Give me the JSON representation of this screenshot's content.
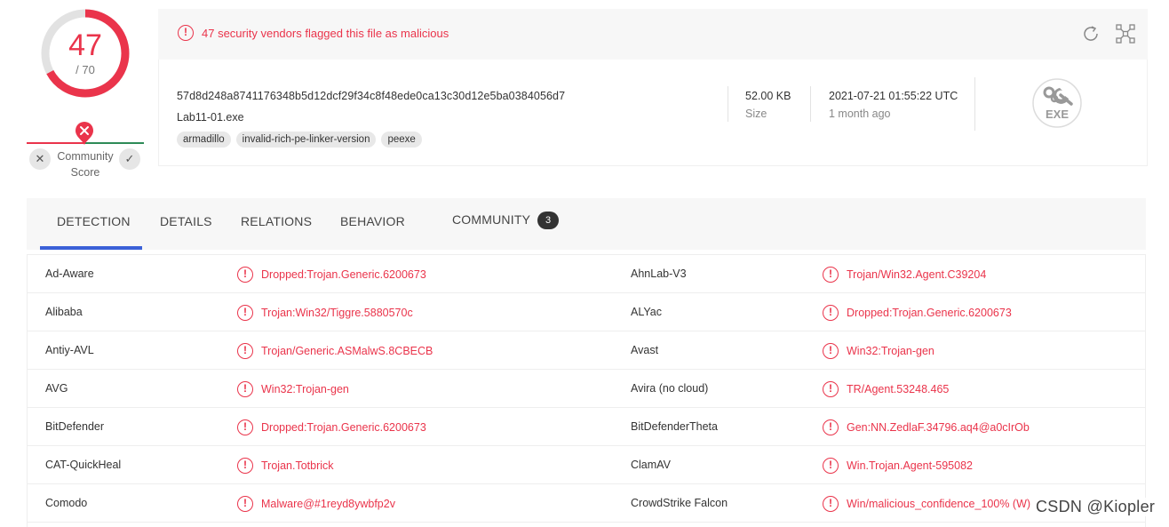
{
  "score": {
    "detected": "47",
    "total": "/ 70",
    "fraction": 0.671,
    "community_label_1": "Community",
    "community_label_2": "Score",
    "accent": "#ea344b"
  },
  "header": {
    "alert": "47 security vendors flagged this file as malicious",
    "sha256": "57d8d248a8741176348b5d12dcf29f34c8f48ede0ca13c30d12e5ba0384056d7",
    "filename": "Lab11-01.exe",
    "tags": [
      "armadillo",
      "invalid-rich-pe-linker-version",
      "peexe"
    ],
    "size_value": "52.00 KB",
    "size_label": "Size",
    "date_value": "2021-07-21 01:55:22 UTC",
    "date_ago": "1 month ago",
    "file_type": "EXE",
    "icons": [
      "refresh-icon",
      "graph-icon",
      "exe-file-icon"
    ]
  },
  "tabs": [
    {
      "label": "DETECTION",
      "active": true
    },
    {
      "label": "DETAILS"
    },
    {
      "label": "RELATIONS"
    },
    {
      "label": "BEHAVIOR"
    },
    {
      "label": "COMMUNITY",
      "badge": "3"
    }
  ],
  "detections": [
    {
      "vendor_left": "Ad-Aware",
      "result_left": "Dropped:Trojan.Generic.6200673",
      "vendor_right": "AhnLab-V3",
      "result_right": "Trojan/Win32.Agent.C39204"
    },
    {
      "vendor_left": "Alibaba",
      "result_left": "Trojan:Win32/Tiggre.5880570c",
      "vendor_right": "ALYac",
      "result_right": "Dropped:Trojan.Generic.6200673"
    },
    {
      "vendor_left": "Antiy-AVL",
      "result_left": "Trojan/Generic.ASMalwS.8CBECB",
      "vendor_right": "Avast",
      "result_right": "Win32:Trojan-gen"
    },
    {
      "vendor_left": "AVG",
      "result_left": "Win32:Trojan-gen",
      "vendor_right": "Avira (no cloud)",
      "result_right": "TR/Agent.53248.465"
    },
    {
      "vendor_left": "BitDefender",
      "result_left": "Dropped:Trojan.Generic.6200673",
      "vendor_right": "BitDefenderTheta",
      "result_right": "Gen:NN.ZedlaF.34796.aq4@a0cIrOb"
    },
    {
      "vendor_left": "CAT-QuickHeal",
      "result_left": "Trojan.Totbrick",
      "vendor_right": "ClamAV",
      "result_right": "Win.Trojan.Agent-595082"
    },
    {
      "vendor_left": "Comodo",
      "result_left": "Malware@#1reyd8ywbfp2v",
      "vendor_right": "CrowdStrike Falcon",
      "result_right": "Win/malicious_confidence_100% (W)"
    }
  ],
  "watermark": "CSDN @Kiopler"
}
